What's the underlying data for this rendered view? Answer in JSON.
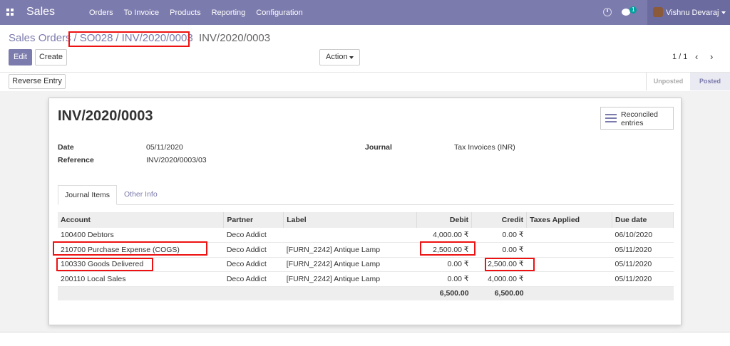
{
  "topbar": {
    "app_name": "Sales",
    "menu": [
      "Orders",
      "To Invoice",
      "Products",
      "Reporting",
      "Configuration"
    ],
    "chat_count": "1",
    "user_name": "Vishnu Devaraj",
    "bg_color": "#7c7bad"
  },
  "breadcrumb": {
    "items": [
      "Sales Orders",
      "SO028",
      "INV/2020/0003"
    ],
    "current": "INV/2020/0003"
  },
  "buttons": {
    "edit": "Edit",
    "create": "Create",
    "action": "Action",
    "reverse_entry": "Reverse Entry"
  },
  "pager": {
    "value": "1 / 1"
  },
  "status": {
    "stages": [
      "Unposted",
      "Posted"
    ],
    "active": "Posted"
  },
  "record": {
    "title": "INV/2020/0003",
    "reconciled_label": "Reconciled entries",
    "date_label": "Date",
    "date": "05/11/2020",
    "reference_label": "Reference",
    "reference": "INV/2020/0003/03",
    "journal_label": "Journal",
    "journal": "Tax Invoices (INR)"
  },
  "tabs": [
    "Journal Items",
    "Other Info"
  ],
  "journal_items": {
    "columns": [
      "Account",
      "Partner",
      "Label",
      "Debit",
      "Credit",
      "Taxes Applied",
      "Due date"
    ],
    "rows": [
      {
        "account": "100400 Debtors",
        "partner": "Deco Addict",
        "label": "",
        "debit": "4,000.00 ₹",
        "credit": "0.00 ₹",
        "taxes": "",
        "due": "06/10/2020"
      },
      {
        "account": "210700 Purchase Expense (COGS)",
        "partner": "Deco Addict",
        "label": "[FURN_2242] Antique Lamp",
        "debit": "2,500.00 ₹",
        "credit": "0.00 ₹",
        "taxes": "",
        "due": "05/11/2020"
      },
      {
        "account": "100330 Goods Delivered",
        "partner": "Deco Addict",
        "label": "[FURN_2242] Antique Lamp",
        "debit": "0.00 ₹",
        "credit": "2,500.00 ₹",
        "taxes": "",
        "due": "05/11/2020"
      },
      {
        "account": "200110 Local Sales",
        "partner": "Deco Addict",
        "label": "[FURN_2242] Antique Lamp",
        "debit": "0.00 ₹",
        "credit": "4,000.00 ₹",
        "taxes": "",
        "due": "05/11/2020"
      }
    ],
    "total_debit": "6,500.00",
    "total_credit": "6,500.00"
  },
  "highlight_color": "#ee1111"
}
